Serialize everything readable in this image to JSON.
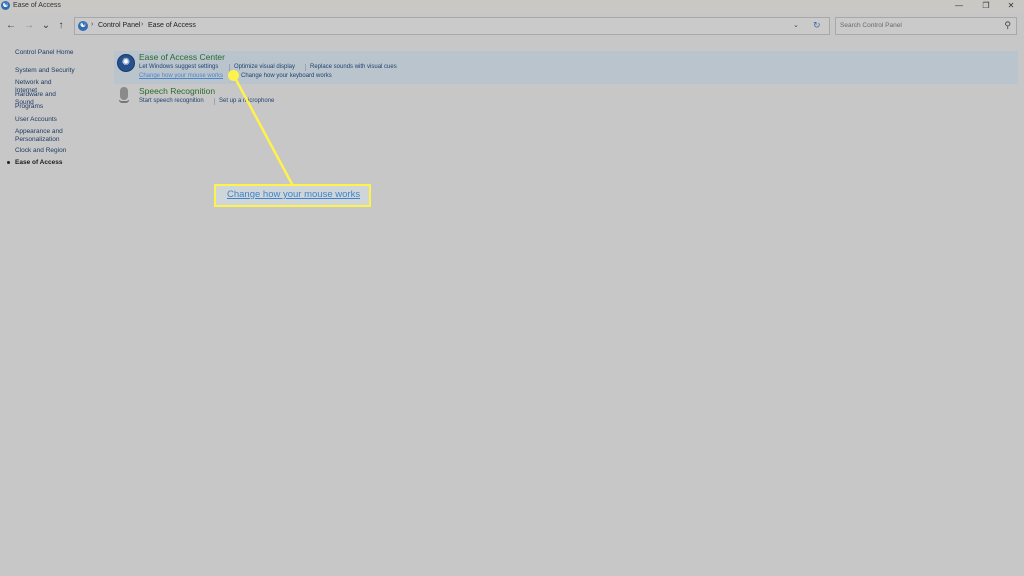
{
  "window": {
    "title": "Ease of Access",
    "minimize_glyph": "—",
    "restore_glyph": "❐",
    "close_glyph": "✕"
  },
  "nav": {
    "back_glyph": "←",
    "forward_glyph": "→",
    "recent_glyph": "⌄",
    "up_glyph": "↑"
  },
  "address": {
    "icon_glyph": "☯",
    "separator_glyph": "›",
    "crumbs": [
      "Control Panel",
      "Ease of Access"
    ],
    "dropdown_glyph": "⌄",
    "refresh_glyph": "↻"
  },
  "search": {
    "placeholder": "Search Control Panel",
    "icon_glyph": "⚲"
  },
  "sidebar": {
    "items": [
      {
        "label": "Control Panel Home"
      },
      {
        "label": "System and Security"
      },
      {
        "label": "Network and Internet"
      },
      {
        "label": "Hardware and Sound"
      },
      {
        "label": "Programs"
      },
      {
        "label": "User Accounts"
      },
      {
        "label": "Appearance and Personalization"
      },
      {
        "label": "Clock and Region"
      },
      {
        "label": "Ease of Access"
      }
    ]
  },
  "categories": {
    "ease": {
      "icon_glyph": "✺",
      "title": "Ease of Access Center",
      "links": [
        "Let Windows suggest settings",
        "Optimize visual display",
        "Replace sounds with visual cues",
        "Change how your mouse works",
        "Change how your keyboard works"
      ]
    },
    "speech": {
      "title": "Speech Recognition",
      "links": [
        "Start speech recognition",
        "Set up a microphone"
      ]
    }
  },
  "callout": {
    "label": "Change how your mouse works",
    "color": "#fff24a"
  }
}
